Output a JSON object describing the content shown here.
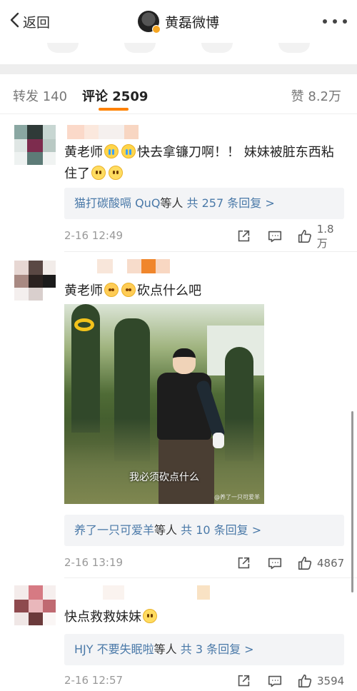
{
  "nav": {
    "back_label": "返回",
    "title": "黄磊微博"
  },
  "tabs": {
    "forward_label": "转发 140",
    "comment_label": "评论 2509",
    "like_label": "赞 8.2万"
  },
  "comments": [
    {
      "text_before": "黄老师",
      "text_middle": "快去拿镰刀啊！！ 妹妹被脏东西粘住了",
      "replies_users": "猫打碳酸嗝 QuQ",
      "replies_mid": "等人",
      "replies_count": "共 257 条回复 >",
      "date": "2-16 12:49",
      "likes": "1.8万"
    },
    {
      "text_before": "黄老师",
      "text_after": "砍点什么吧",
      "media_subtitle": "我必须砍点什么",
      "media_watermark": "@养了一只可爱羊",
      "replies_users": "养了一只可爱羊",
      "replies_mid": "等人",
      "replies_count": "共 10 条回复 >",
      "date": "2-16 13:19",
      "likes": "4867"
    },
    {
      "text": "快点救救妹妹",
      "replies_users": "HJY 不要失眠啦",
      "replies_mid": "等人",
      "replies_count": "共 3 条回复 >",
      "date": "2-16 12:57",
      "likes": "3594"
    }
  ],
  "icons": {
    "back": "chevron-left-icon",
    "more": "more-dots-icon",
    "share": "share-icon",
    "reply": "comment-icon",
    "like": "thumbs-up-icon"
  },
  "colors": {
    "accent": "#ff8200",
    "link": "#4a79a8",
    "muted": "#999999"
  }
}
